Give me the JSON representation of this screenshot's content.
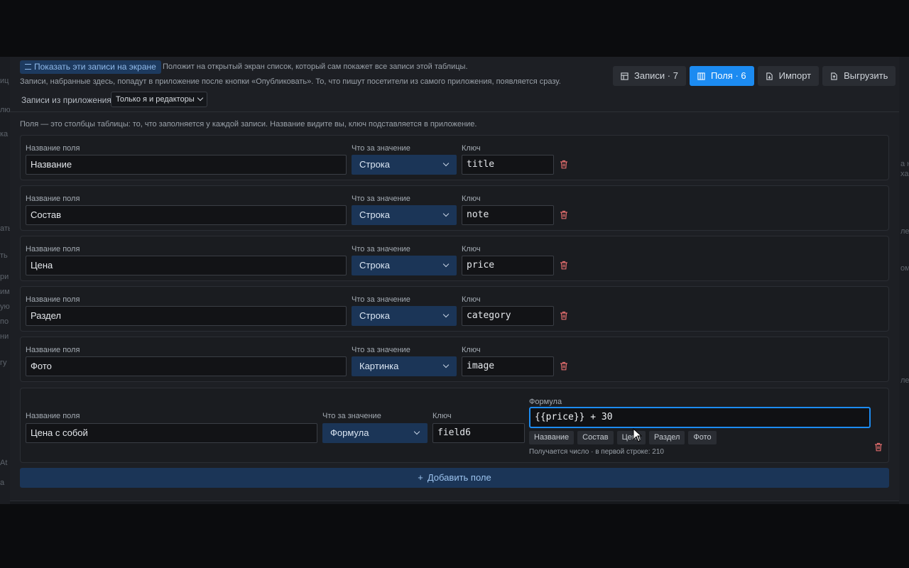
{
  "top": {
    "show_button": "Показать эти записи на экране",
    "show_note": "Положит на открытый экран список, который сам покажет все записи этой таблицы.",
    "publish_note": "Записи, набранные здесь, попадут в приложение после кнопки «Опубликовать». То, что пишут посетители из самого приложения, появляется сразу.",
    "from_app_label": "Записи из приложения:",
    "from_app_value": "Только я и редакторы"
  },
  "tabs": [
    {
      "label": "Записи · 7",
      "icon": "table-icon",
      "active": false
    },
    {
      "label": "Поля · 6",
      "icon": "columns-icon",
      "active": true
    },
    {
      "label": "Импорт",
      "icon": "file-import-icon",
      "active": false
    },
    {
      "label": "Выгрузить",
      "icon": "file-export-icon",
      "active": false
    }
  ],
  "fields_note": "Поля — это столбцы таблицы: то, что заполняется у каждой записи. Название видите вы, ключ подставляется в приложение.",
  "labels": {
    "name": "Название поля",
    "type": "Что за значение",
    "key": "Ключ",
    "formula": "Формула"
  },
  "fields": [
    {
      "name": "Название",
      "type": "Строка",
      "key": "title"
    },
    {
      "name": "Состав",
      "type": "Строка",
      "key": "note"
    },
    {
      "name": "Цена",
      "type": "Строка",
      "key": "price"
    },
    {
      "name": "Раздел",
      "type": "Строка",
      "key": "category"
    },
    {
      "name": "Фото",
      "type": "Картинка",
      "key": "image"
    }
  ],
  "formula_field": {
    "name": "Цена с собой",
    "type": "Формула",
    "key": "field6",
    "formula": "{{price}} + 30",
    "chips": [
      "Название",
      "Состав",
      "Цена",
      "Раздел",
      "Фото"
    ],
    "hint": "Получается число · в первой строке: 210"
  },
  "add_field": "Добавить поле",
  "background_fragments": {
    "left": [
      "иц",
      "лю",
      "ка",
      "ать",
      "ть",
      "ри",
      "им",
      "ую",
      "по",
      "ни",
      "гу",
      "At",
      "а"
    ],
    "right": [
      "а н",
      "ха",
      "ле",
      "ом",
      "ле"
    ]
  },
  "colors": {
    "accent": "#1c8bf1",
    "select_bg": "#1b3557",
    "danger": "#e06c6c"
  }
}
